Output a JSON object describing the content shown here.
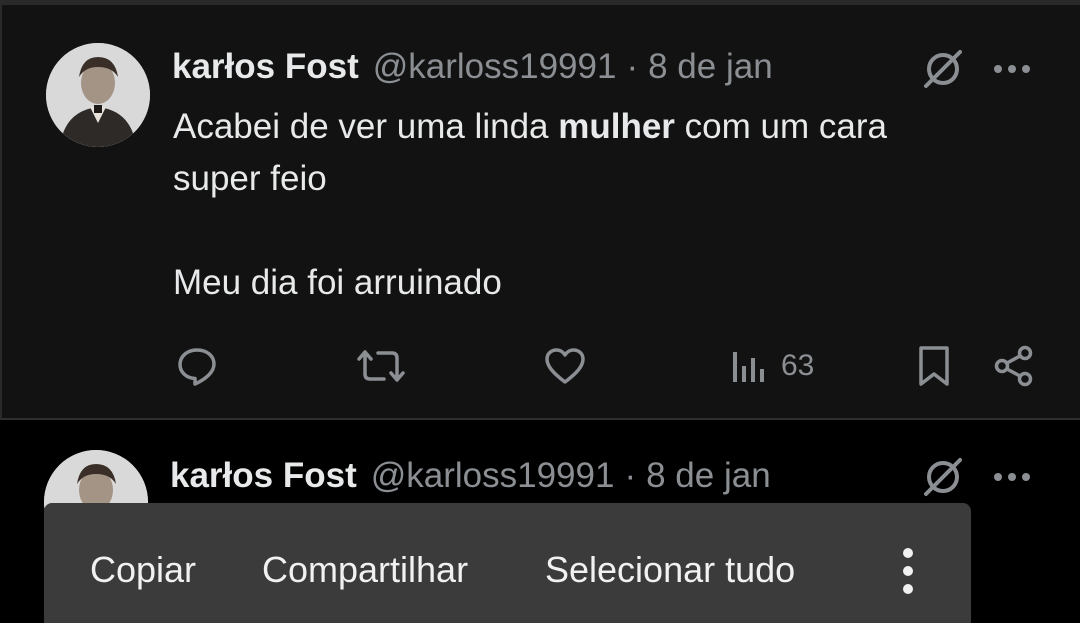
{
  "tweets": [
    {
      "name": "karłos Fost",
      "handle": "@karloss19991",
      "separator": "·",
      "time": "8 de jan",
      "body": {
        "line1_before": "Acabei de ver uma linda ",
        "line1_bold": "mulher",
        "line1_after": " com um cara",
        "line2": "super feio",
        "line3": "Meu dia foi arruinado"
      },
      "views": "63"
    },
    {
      "name": "karłos Fost",
      "handle": "@karloss19991",
      "separator": "·",
      "time": "8 de jan"
    }
  ],
  "context_menu": {
    "items": [
      "Copiar",
      "Compartilhar",
      "Selecionar tudo"
    ]
  },
  "icons": {
    "grok": "grok-icon",
    "more": "more-horizontal-icon",
    "reply": "reply-icon",
    "retweet": "retweet-icon",
    "like": "heart-icon",
    "views": "views-icon",
    "bookmark": "bookmark-icon",
    "share": "share-icon",
    "menu_more": "more-vertical-icon"
  },
  "colors": {
    "background": "#000000",
    "tweet_background": "#121212",
    "text": "#e7e9ea",
    "secondary_text": "#8b8f93",
    "menu_background": "#3b3b3b"
  }
}
